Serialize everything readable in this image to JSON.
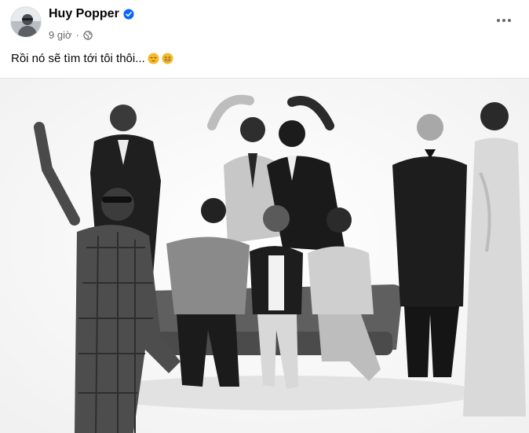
{
  "post": {
    "author_name": "Huy Popper",
    "timestamp": "9 giờ",
    "separator": "·",
    "audience_icon": "globe-icon",
    "verified_icon": "verified-badge-icon",
    "more_icon": "more-options-icon",
    "caption": "Rồi nó sẽ tìm tới tôi thôi...",
    "caption_emojis": [
      "pensive-face-emoji",
      "grinning-face-emoji"
    ]
  },
  "colors": {
    "name_text": "#050505",
    "meta_text": "#65676b",
    "verified_badge": "#0866ff",
    "divider": "#e4e6eb",
    "emoji_yellow": "#f7b928"
  },
  "photo": {
    "alt": "group-photo",
    "style": "black-and-white"
  }
}
